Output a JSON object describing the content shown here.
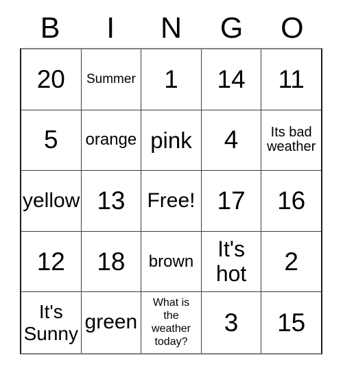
{
  "card": {
    "title": "BINGO",
    "headers": [
      "B",
      "I",
      "N",
      "G",
      "O"
    ],
    "rows": [
      [
        {
          "text": "20",
          "size": "sz-num"
        },
        {
          "text": "Summer",
          "size": "sz-word-xxs"
        },
        {
          "text": "1",
          "size": "sz-num"
        },
        {
          "text": "14",
          "size": "sz-num"
        },
        {
          "text": "11",
          "size": "sz-num"
        }
      ],
      [
        {
          "text": "5",
          "size": "sz-num"
        },
        {
          "text": "orange",
          "size": "sz-word-sm"
        },
        {
          "text": "pink",
          "size": "sz-word-lg"
        },
        {
          "text": "4",
          "size": "sz-num"
        },
        {
          "text": "Its bad\nweather",
          "size": "sz-word-xs"
        }
      ],
      [
        {
          "text": "yellow",
          "size": "sz-word-md"
        },
        {
          "text": "13",
          "size": "sz-num"
        },
        {
          "text": "Free!",
          "size": "sz-word-md"
        },
        {
          "text": "17",
          "size": "sz-num"
        },
        {
          "text": "16",
          "size": "sz-num"
        }
      ],
      [
        {
          "text": "12",
          "size": "sz-num"
        },
        {
          "text": "18",
          "size": "sz-num"
        },
        {
          "text": "brown",
          "size": "sz-word-sm"
        },
        {
          "text": "It's\nhot",
          "size": "sz-two-lg"
        },
        {
          "text": "2",
          "size": "sz-num"
        }
      ],
      [
        {
          "text": "It's\nSunny",
          "size": "sz-two-md"
        },
        {
          "text": "green",
          "size": "sz-word-md"
        },
        {
          "text": "What is\nthe\nweather\ntoday?",
          "size": "sz-tiny"
        },
        {
          "text": "3",
          "size": "sz-num"
        },
        {
          "text": "15",
          "size": "sz-num"
        }
      ]
    ],
    "free_space": {
      "row": 2,
      "column": 2,
      "label": "Free!"
    },
    "colors": {
      "background": "#ffffff",
      "text": "#000000",
      "grid_line": "#3d3d3d",
      "border_side": "#1a1a1a",
      "border_top_bottom": "#808080"
    }
  }
}
